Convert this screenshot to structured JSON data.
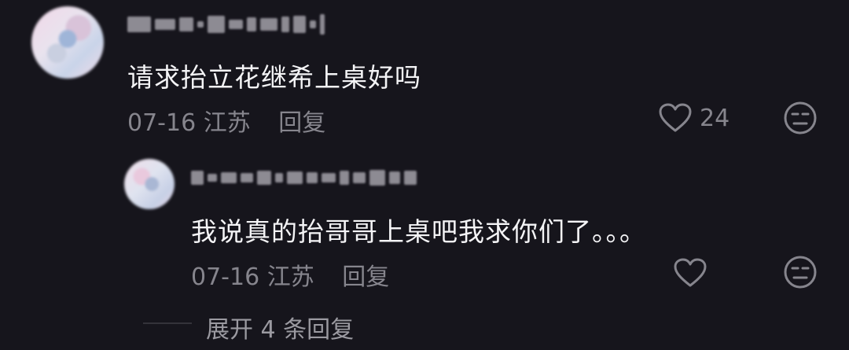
{
  "comment": {
    "text": "请求抬立花继希上桌好吗",
    "date": "07-16",
    "location": "江苏",
    "reply_label": "回复",
    "like_count": "24"
  },
  "reply": {
    "text": "我说真的抬哥哥上桌吧我求你们了。。。",
    "date": "07-16",
    "location": "江苏",
    "reply_label": "回复"
  },
  "expand": {
    "label": "展开 4 条回复"
  },
  "icons": {
    "like": "heart-outline-icon",
    "dislike": "unimpressed-face-icon"
  },
  "colors": {
    "background": "#16151c",
    "text_primary": "#f4f4f6",
    "text_secondary": "#86858d"
  }
}
